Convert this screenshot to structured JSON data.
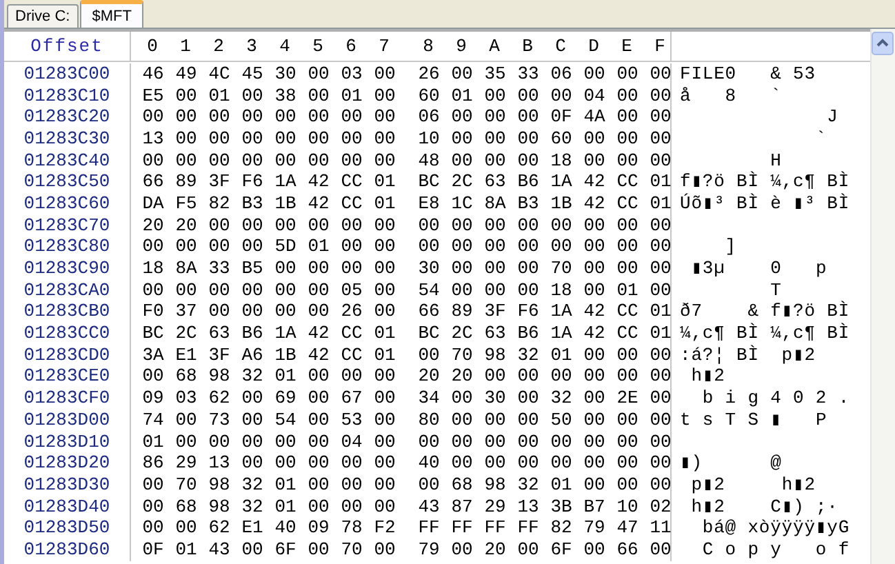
{
  "tabs": [
    {
      "label": "Drive C:",
      "selected": false
    },
    {
      "label": "$MFT",
      "selected": true
    }
  ],
  "header": {
    "offset": "Offset",
    "columns": [
      "0",
      "1",
      "2",
      "3",
      "4",
      "5",
      "6",
      "7",
      "8",
      "9",
      "A",
      "B",
      "C",
      "D",
      "E",
      "F"
    ]
  },
  "rows": [
    {
      "offset": "01283C00",
      "bytes": [
        "46",
        "49",
        "4C",
        "45",
        "30",
        "00",
        "03",
        "00",
        "26",
        "00",
        "35",
        "33",
        "06",
        "00",
        "00",
        "00"
      ],
      "ascii": "FILE0   & 53"
    },
    {
      "offset": "01283C10",
      "bytes": [
        "E5",
        "00",
        "01",
        "00",
        "38",
        "00",
        "01",
        "00",
        "60",
        "01",
        "00",
        "00",
        "00",
        "04",
        "00",
        "00"
      ],
      "ascii": "å   8   `"
    },
    {
      "offset": "01283C20",
      "bytes": [
        "00",
        "00",
        "00",
        "00",
        "00",
        "00",
        "00",
        "00",
        "06",
        "00",
        "00",
        "00",
        "0F",
        "4A",
        "00",
        "00"
      ],
      "ascii": "             J"
    },
    {
      "offset": "01283C30",
      "bytes": [
        "13",
        "00",
        "00",
        "00",
        "00",
        "00",
        "00",
        "00",
        "10",
        "00",
        "00",
        "00",
        "60",
        "00",
        "00",
        "00"
      ],
      "ascii": "            `"
    },
    {
      "offset": "01283C40",
      "bytes": [
        "00",
        "00",
        "00",
        "00",
        "00",
        "00",
        "00",
        "00",
        "48",
        "00",
        "00",
        "00",
        "18",
        "00",
        "00",
        "00"
      ],
      "ascii": "        H"
    },
    {
      "offset": "01283C50",
      "bytes": [
        "66",
        "89",
        "3F",
        "F6",
        "1A",
        "42",
        "CC",
        "01",
        "BC",
        "2C",
        "63",
        "B6",
        "1A",
        "42",
        "CC",
        "01"
      ],
      "ascii": "f▮?ö BÌ ¼,c¶ BÌ"
    },
    {
      "offset": "01283C60",
      "bytes": [
        "DA",
        "F5",
        "82",
        "B3",
        "1B",
        "42",
        "CC",
        "01",
        "E8",
        "1C",
        "8A",
        "B3",
        "1B",
        "42",
        "CC",
        "01"
      ],
      "ascii": "Úõ▮³ BÌ è ▮³ BÌ"
    },
    {
      "offset": "01283C70",
      "bytes": [
        "20",
        "20",
        "00",
        "00",
        "00",
        "00",
        "00",
        "00",
        "00",
        "00",
        "00",
        "00",
        "00",
        "00",
        "00",
        "00"
      ]
    },
    {
      "offset": "01283C80",
      "bytes": [
        "00",
        "00",
        "00",
        "00",
        "5D",
        "01",
        "00",
        "00",
        "00",
        "00",
        "00",
        "00",
        "00",
        "00",
        "00",
        "00"
      ],
      "ascii": "    ]"
    },
    {
      "offset": "01283C90",
      "bytes": [
        "18",
        "8A",
        "33",
        "B5",
        "00",
        "00",
        "00",
        "00",
        "30",
        "00",
        "00",
        "00",
        "70",
        "00",
        "00",
        "00"
      ],
      "ascii": " ▮3µ    0   p"
    },
    {
      "offset": "01283CA0",
      "bytes": [
        "00",
        "00",
        "00",
        "00",
        "00",
        "00",
        "05",
        "00",
        "54",
        "00",
        "00",
        "00",
        "18",
        "00",
        "01",
        "00"
      ],
      "ascii": "        T"
    },
    {
      "offset": "01283CB0",
      "bytes": [
        "F0",
        "37",
        "00",
        "00",
        "00",
        "00",
        "26",
        "00",
        "66",
        "89",
        "3F",
        "F6",
        "1A",
        "42",
        "CC",
        "01"
      ],
      "ascii": "ð7    & f▮?ö BÌ"
    },
    {
      "offset": "01283CC0",
      "bytes": [
        "BC",
        "2C",
        "63",
        "B6",
        "1A",
        "42",
        "CC",
        "01",
        "BC",
        "2C",
        "63",
        "B6",
        "1A",
        "42",
        "CC",
        "01"
      ],
      "ascii": "¼,c¶ BÌ ¼,c¶ BÌ"
    },
    {
      "offset": "01283CD0",
      "bytes": [
        "3A",
        "E1",
        "3F",
        "A6",
        "1B",
        "42",
        "CC",
        "01",
        "00",
        "70",
        "98",
        "32",
        "01",
        "00",
        "00",
        "00"
      ],
      "ascii": ":á?¦ BÌ  p▮2"
    },
    {
      "offset": "01283CE0",
      "bytes": [
        "00",
        "68",
        "98",
        "32",
        "01",
        "00",
        "00",
        "00",
        "20",
        "20",
        "00",
        "00",
        "00",
        "00",
        "00",
        "00"
      ],
      "ascii": " h▮2"
    },
    {
      "offset": "01283CF0",
      "bytes": [
        "09",
        "03",
        "62",
        "00",
        "69",
        "00",
        "67",
        "00",
        "34",
        "00",
        "30",
        "00",
        "32",
        "00",
        "2E",
        "00"
      ],
      "ascii": "  b i g 4 0 2 ."
    },
    {
      "offset": "01283D00",
      "bytes": [
        "74",
        "00",
        "73",
        "00",
        "54",
        "00",
        "53",
        "00",
        "80",
        "00",
        "00",
        "00",
        "50",
        "00",
        "00",
        "00"
      ],
      "ascii": "t s T S ▮   P"
    },
    {
      "offset": "01283D10",
      "bytes": [
        "01",
        "00",
        "00",
        "00",
        "00",
        "00",
        "04",
        "00",
        "00",
        "00",
        "00",
        "00",
        "00",
        "00",
        "00",
        "00"
      ]
    },
    {
      "offset": "01283D20",
      "bytes": [
        "86",
        "29",
        "13",
        "00",
        "00",
        "00",
        "00",
        "00",
        "40",
        "00",
        "00",
        "00",
        "00",
        "00",
        "00",
        "00"
      ],
      "ascii": "▮)      @"
    },
    {
      "offset": "01283D30",
      "bytes": [
        "00",
        "70",
        "98",
        "32",
        "01",
        "00",
        "00",
        "00",
        "00",
        "68",
        "98",
        "32",
        "01",
        "00",
        "00",
        "00"
      ],
      "ascii": " p▮2     h▮2"
    },
    {
      "offset": "01283D40",
      "bytes": [
        "00",
        "68",
        "98",
        "32",
        "01",
        "00",
        "00",
        "00",
        "43",
        "87",
        "29",
        "13",
        "3B",
        "B7",
        "10",
        "02"
      ],
      "ascii": " h▮2    C▮) ;·"
    },
    {
      "offset": "01283D50",
      "bytes": [
        "00",
        "00",
        "62",
        "E1",
        "40",
        "09",
        "78",
        "F2",
        "FF",
        "FF",
        "FF",
        "FF",
        "82",
        "79",
        "47",
        "11"
      ],
      "ascii": "  bá@ xòÿÿÿÿ▮yG"
    },
    {
      "offset": "01283D60",
      "bytes": [
        "0F",
        "01",
        "43",
        "00",
        "6F",
        "00",
        "70",
        "00",
        "79",
        "00",
        "20",
        "00",
        "6F",
        "00",
        "66",
        "00"
      ],
      "ascii": "  C o p y   o f"
    }
  ]
}
